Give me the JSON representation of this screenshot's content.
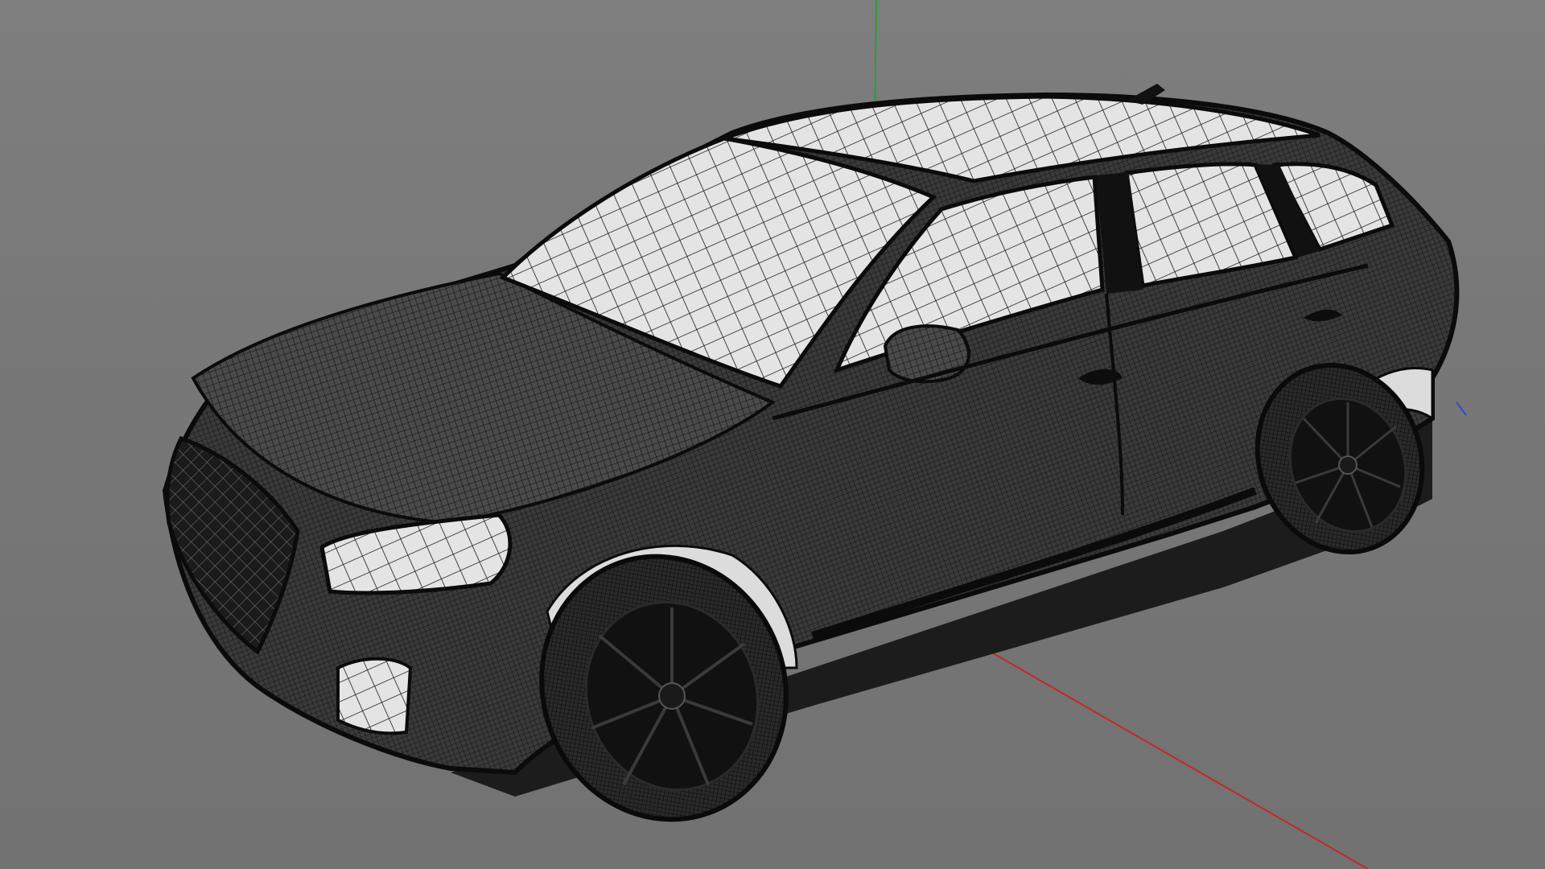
{
  "viewport": {
    "background_color": "#777777",
    "axis_colors": {
      "x_axis": "#c62828",
      "y_axis": "#2e9b3a",
      "z_axis": "#2a4bd0"
    },
    "model": {
      "kind": "wireframe car mesh",
      "shaded_color": "#111111",
      "surface_color": "#e6e6e6"
    }
  }
}
